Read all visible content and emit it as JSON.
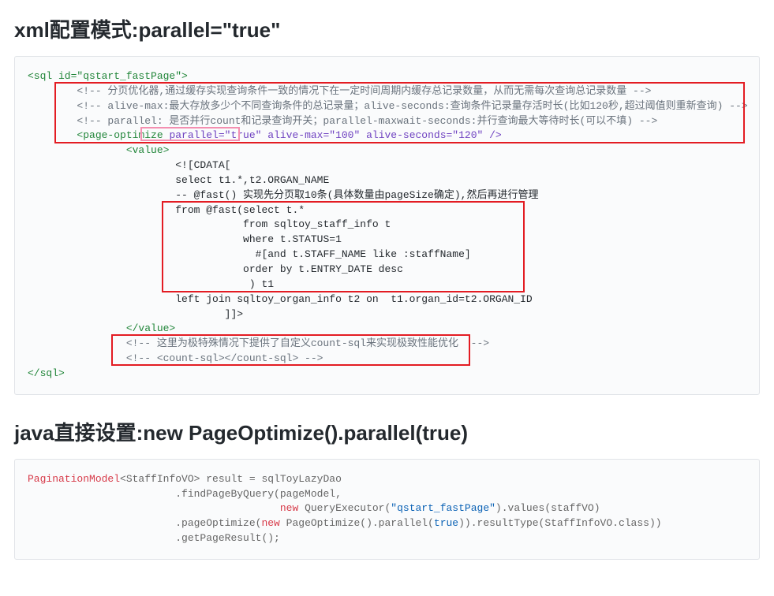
{
  "section1": {
    "title": "xml配置模式:parallel=\"true\""
  },
  "section2": {
    "title": "java直接设置:new PageOptimize().parallel(true)"
  },
  "xml": {
    "l1": "<sql id=\"qstart_fastPage\">",
    "l2": "        <!-- 分页优化器,通过缓存实现查询条件一致的情况下在一定时间周期内缓存总记录数量，从而无需每次查询总记录数量 -->",
    "l3": "        <!-- alive-max:最大存放多少个不同查询条件的总记录量；alive-seconds:查询条件记录量存活时长(比如120秒,超过阈值则重新查询) -->",
    "l4": "        <!-- parallel: 是否并行count和记录查询开关；parallel-maxwait-seconds:并行查询最大等待时长(可以不填) -->",
    "l5a": "        <page-optimize ",
    "l5b": "parallel=\"true\"",
    "l5c": " alive-max=\"100\" alive-seconds=\"120\" />",
    "l6": "                <value>",
    "l7": "                        <![CDATA[",
    "l8": "                        select t1.*,t2.ORGAN_NAME",
    "l9": "                        -- @fast() 实现先分页取10条(具体数量由pageSize确定),然后再进行管理",
    "l10": "                        from @fast(select t.*",
    "l11": "                                   from sqltoy_staff_info t",
    "l12": "                                   where t.STATUS=1",
    "l13": "                                     #[and t.STAFF_NAME like :staffName]",
    "l14": "                                   order by t.ENTRY_DATE desc",
    "l15": "                                    ) t1",
    "l16": "                        left join sqltoy_organ_info t2 on  t1.organ_id=t2.ORGAN_ID",
    "l17": "                                ]]>",
    "l18": "                </value>",
    "l19": "                <!-- 这里为极特殊情况下提供了自定义count-sql来实现极致性能优化  -->",
    "l20": "                <!-- <count-sql></count-sql> -->",
    "l21": "</sql>"
  },
  "java": {
    "l1a": "PaginationModel",
    "l1b": "<StaffInfoVO> result = sqlToyLazyDao",
    "l2": "                        .findPageByQuery(pageModel,",
    "l3a": "                                         ",
    "l3b": "new",
    "l3c": " QueryExecutor(",
    "l3d": "\"qstart_fastPage\"",
    "l3e": ").values(staffVO)",
    "l4a": "                        .pageOptimize(",
    "l4b": "new",
    "l4c": " PageOptimize().parallel(",
    "l4d": "true",
    "l4e": ")).resultType(StaffInfoVO.class))",
    "l5": "                        .getPageResult();"
  }
}
